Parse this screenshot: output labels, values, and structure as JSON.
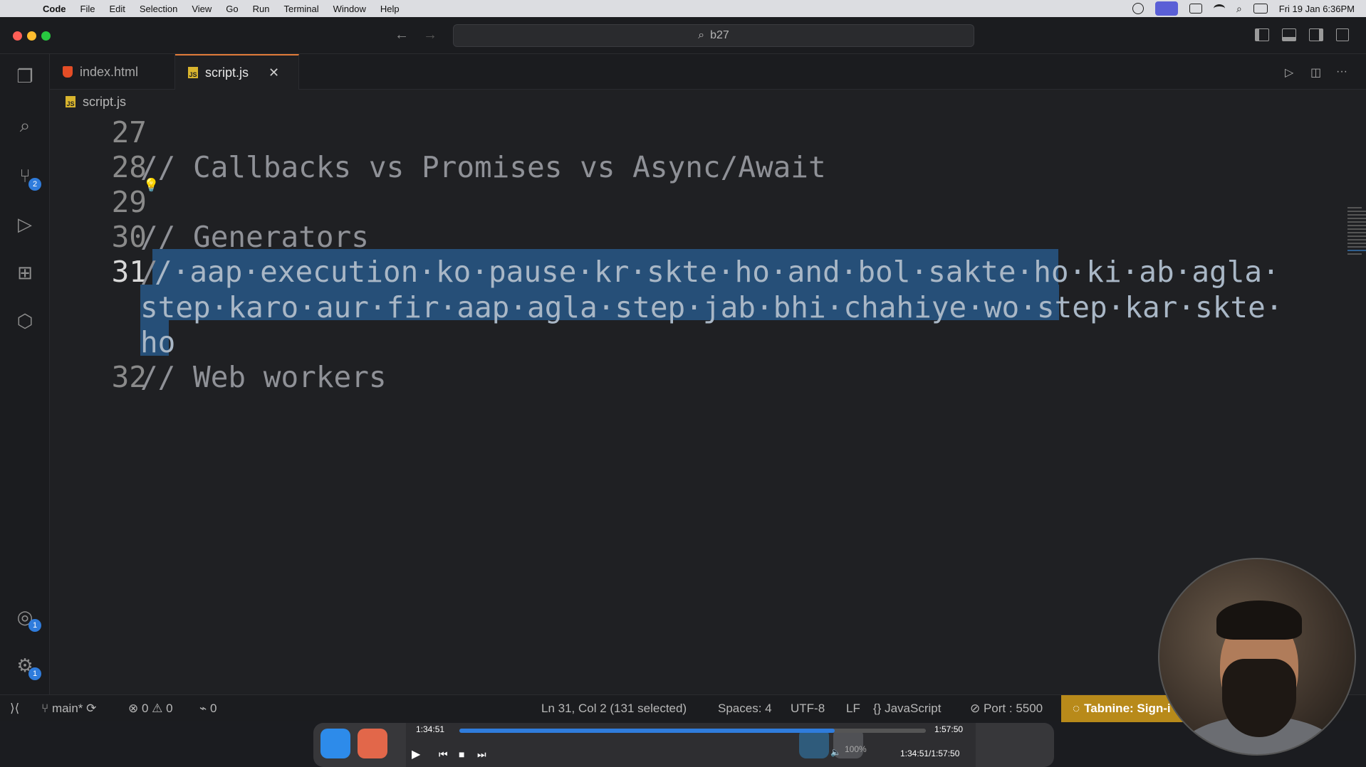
{
  "menubar": {
    "apple_icon": "apple-logo",
    "items": [
      "Code",
      "File",
      "Edit",
      "Selection",
      "View",
      "Go",
      "Run",
      "Terminal",
      "Window",
      "Help"
    ],
    "datetime": "Fri 19 Jan  6:36PM"
  },
  "titlebar": {
    "search": "b27"
  },
  "activitybar": {
    "source_control_badge": "2",
    "accounts_badge": "1",
    "settings_badge": "1"
  },
  "tabs": [
    {
      "label": "index.html",
      "icon": "html5-icon",
      "active": false
    },
    {
      "label": "script.js",
      "icon": "js-icon",
      "active": true,
      "file_icon_text": "JS"
    }
  ],
  "breadcrumb": {
    "file": "script.js",
    "file_icon_text": "JS"
  },
  "editor": {
    "lines": [
      {
        "number": "27",
        "text": ""
      },
      {
        "number": "28",
        "text": "// Callbacks vs Promises vs Async/Await"
      },
      {
        "number": "29",
        "text": ""
      },
      {
        "number": "30",
        "text": "// Generators"
      },
      {
        "number": "31",
        "text_first": "/",
        "text_selected_1": "/·aap·execution·ko·pause·kr·skte·ho·and·bol·sakte·ho·ki·ab·agla·",
        "text_selected_2": "step·karo·aur·fir·aap·agla·step·jab·bhi·chahiye·wo·step·kar·skte·",
        "text_selected_3": "ho"
      },
      {
        "number": "32",
        "text": "// Web workers"
      }
    ],
    "current_line": "31"
  },
  "statusbar": {
    "branch": "main*",
    "errors": "0",
    "warnings": "0",
    "ports": "0",
    "cursor": "Ln 31, Col 2 (131 selected)",
    "spaces": "Spaces: 4",
    "encoding": "UTF-8",
    "eol": "LF",
    "language": "JavaScript",
    "live_server": "Port : 5500",
    "tabnine": "Tabnine: Sign-i"
  },
  "media": {
    "elapsed": "1:34:51",
    "duration": "1:57:50",
    "position": "1:34:51/1:57:50",
    "volume": "100%",
    "progress_fraction": 0.805
  },
  "colors": {
    "selection": "#264f78",
    "tab_accent": "#e07b39",
    "tabnine": "#b88a1a",
    "badge": "#2f7cdc"
  }
}
